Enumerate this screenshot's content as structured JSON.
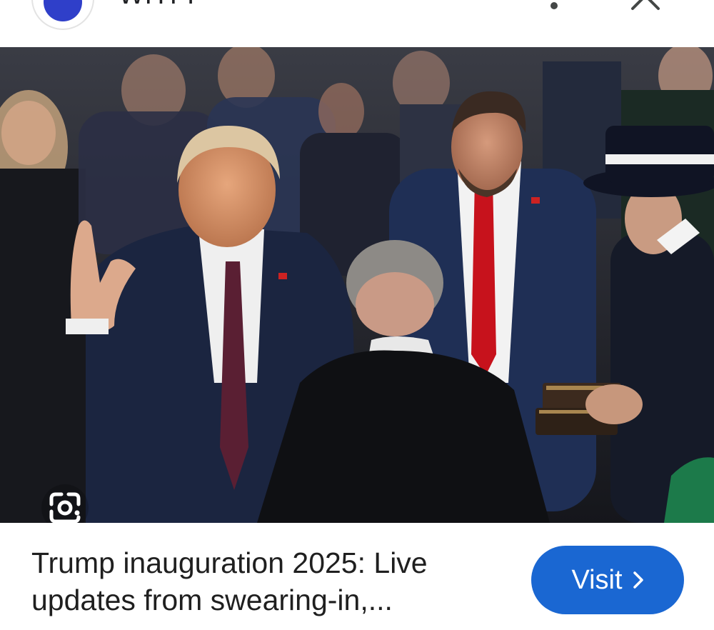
{
  "header": {
    "source_name": "WHTT",
    "source_icon": "publisher-logo-icon",
    "more_icon": "more-vertical-icon",
    "close_icon": "close-icon"
  },
  "image": {
    "description_icon": "photo",
    "lens_icon": "google-lens-icon"
  },
  "result": {
    "title_line1": "Trump inauguration 2025: Live",
    "title_line2": "updates from swearing-in,...",
    "visit_label": "Visit",
    "visit_icon": "chevron-right-icon"
  },
  "colors": {
    "accent": "#1a67d2",
    "logo_blue": "#2f3fc9",
    "text": "#1f1f1f"
  }
}
